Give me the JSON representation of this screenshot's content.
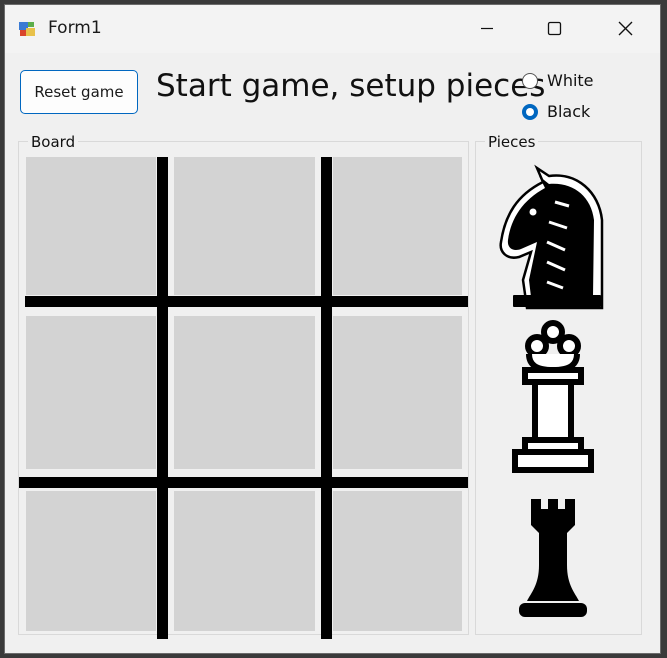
{
  "window": {
    "title": "Form1",
    "icon": "winforms-app-icon"
  },
  "titlebar_buttons": {
    "minimize": "minimize-icon",
    "maximize": "maximize-icon",
    "close": "close-icon"
  },
  "toolbar": {
    "reset_label": "Reset game"
  },
  "status": {
    "heading": "Start game, setup pieces"
  },
  "color_choice": {
    "options": [
      {
        "label": "White",
        "selected": false
      },
      {
        "label": "Black",
        "selected": true
      }
    ]
  },
  "board": {
    "label": "Board",
    "rows": 3,
    "cols": 3,
    "cell_color": "#d3d3d3"
  },
  "pieces": {
    "label": "Pieces",
    "items": [
      {
        "name": "knight",
        "color": "black"
      },
      {
        "name": "queen",
        "color": "white"
      },
      {
        "name": "rook",
        "color": "black"
      }
    ]
  },
  "colors": {
    "accent": "#0067c0"
  }
}
